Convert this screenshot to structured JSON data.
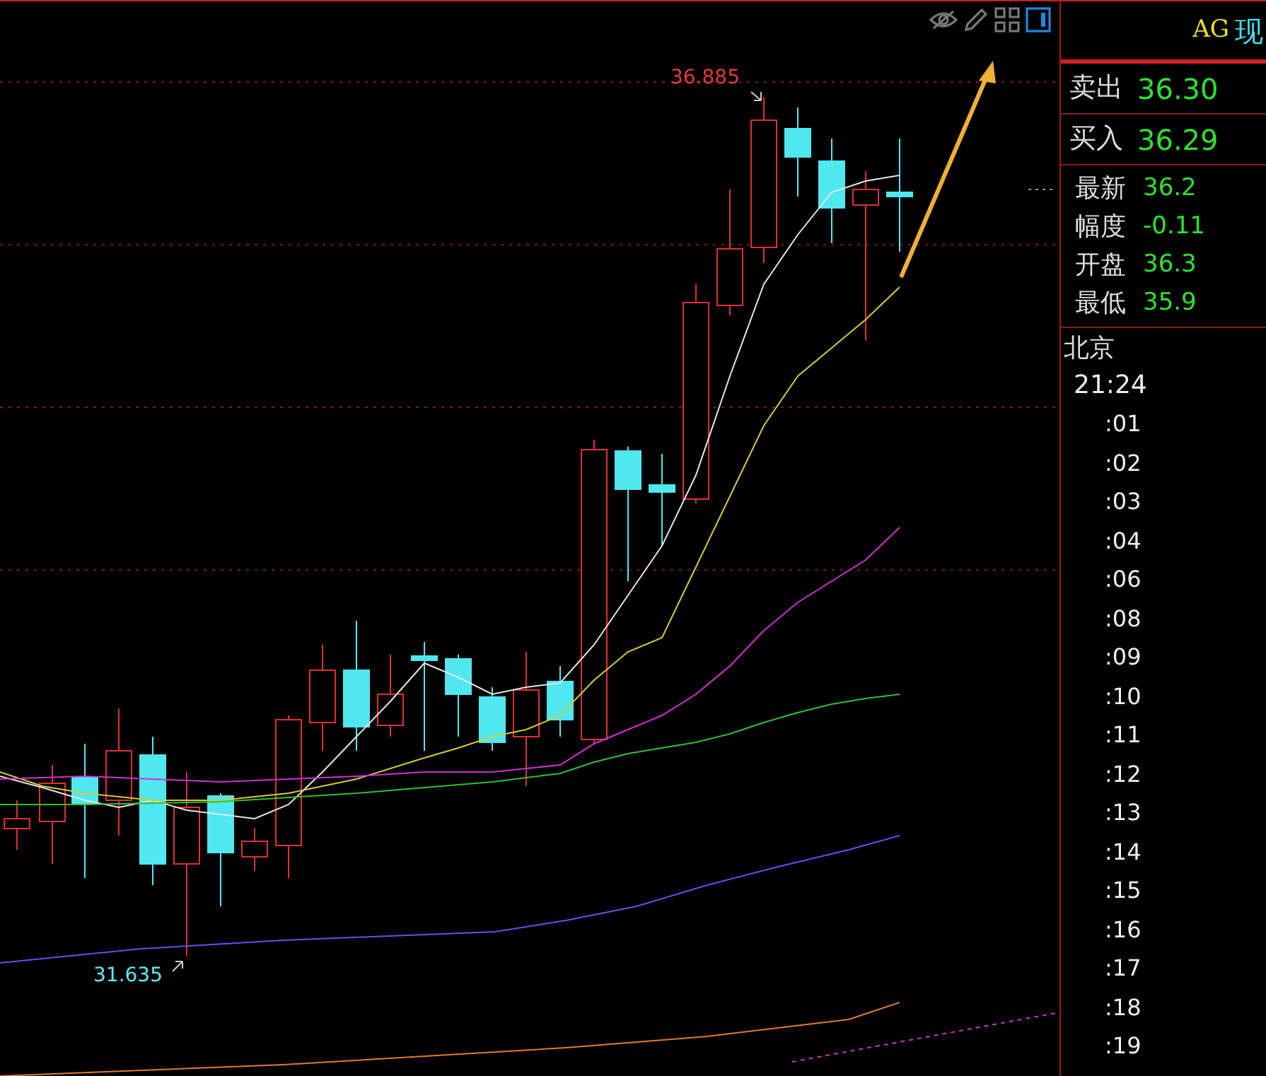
{
  "chart": {
    "high_label": "36.885",
    "low_label": "31.635"
  },
  "quote_panel": {
    "symbol": "AG",
    "name": "现",
    "bid_ask": [
      {
        "label": "卖出",
        "value": "36.30"
      },
      {
        "label": "买入",
        "value": "36.29"
      }
    ],
    "stats": [
      {
        "label": "最新",
        "value": "36.2"
      },
      {
        "label": "幅度",
        "value": "-0.11"
      },
      {
        "label": "开盘",
        "value": "36.3"
      },
      {
        "label": "最低",
        "value": "35.9"
      }
    ],
    "city": "北京",
    "time": "21:24",
    "ticks": [
      ":01",
      ":02",
      ":03",
      ":04",
      ":06",
      ":08",
      ":09",
      ":10",
      ":11",
      ":12",
      ":13",
      ":14",
      ":15",
      ":16",
      ":17",
      ":18",
      ":19"
    ]
  }
}
